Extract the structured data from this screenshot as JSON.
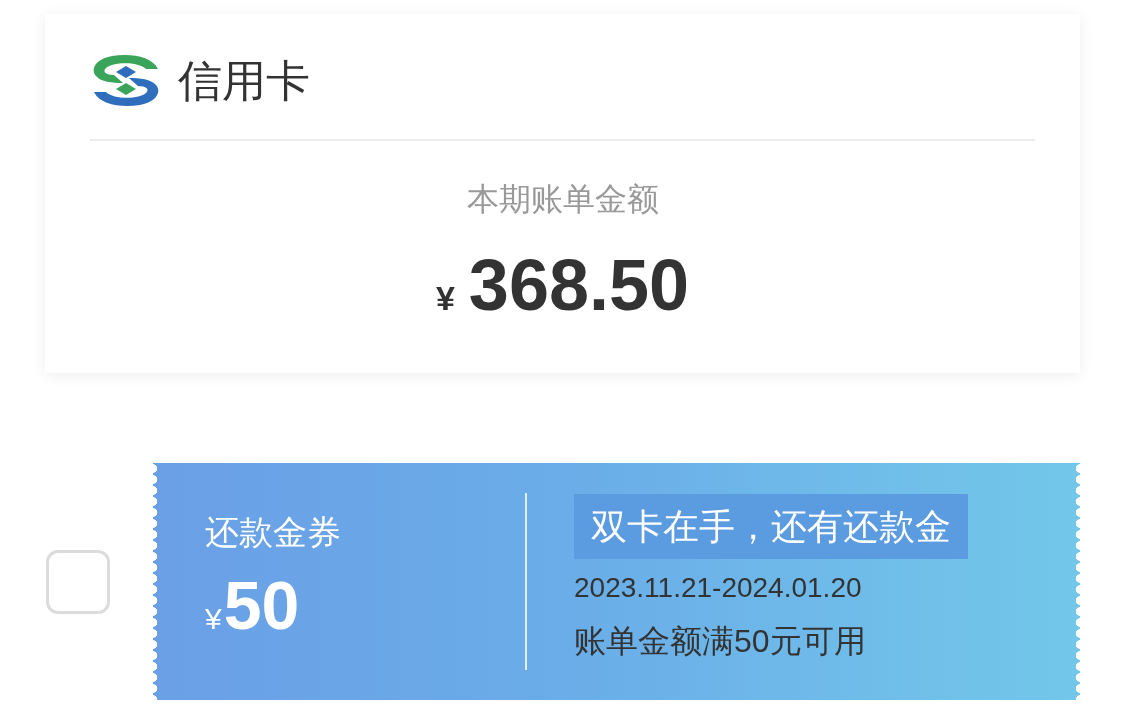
{
  "card": {
    "title": "信用卡",
    "bill_label": "本期账单金额",
    "currency": "¥",
    "amount": "368.50"
  },
  "coupons": [
    {
      "selected": false,
      "title": "还款金券",
      "currency": "¥",
      "value": "50",
      "tag": "双卡在手，还有还款金",
      "validity": "2023.11.21-2024.01.20",
      "condition": "账单金额满50元可用"
    }
  ]
}
